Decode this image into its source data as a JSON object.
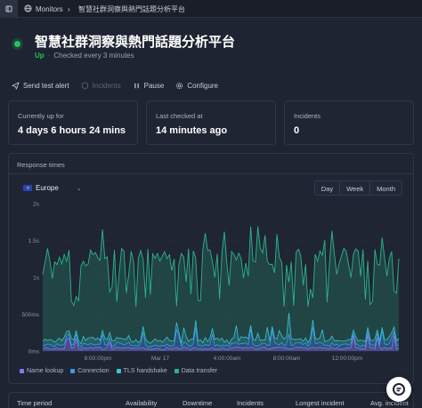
{
  "breadcrumb": {
    "monitors_label": "Monitors",
    "separator": "›",
    "current": "智慧社群洞察與熱門話題分析平台"
  },
  "header": {
    "title": "智慧社群洞察與熱門話題分析平台",
    "status": "Up",
    "separator": "·",
    "check_interval": "Checked every 3 minutes",
    "status_color": "#22c55e"
  },
  "actions": {
    "send_test_alert": "Send test alert",
    "incidents": "Incidents",
    "pause": "Pause",
    "configure": "Configure"
  },
  "stats": [
    {
      "label": "Currently up for",
      "value": "4 days 6 hours 24 mins"
    },
    {
      "label": "Last checked at",
      "value": "14 minutes ago"
    },
    {
      "label": "Incidents",
      "value": "0"
    }
  ],
  "response_times": {
    "title": "Response times",
    "region": "Europe",
    "range_buttons": [
      "Day",
      "Week",
      "Month"
    ]
  },
  "chart_data": {
    "type": "area",
    "y_ticks": [
      "0ms",
      "500ms",
      "1s",
      "1.5s",
      "2s"
    ],
    "ylim": [
      0,
      2000
    ],
    "x_ticks": [
      "8:00:00pm",
      "Mar 17",
      "4:00:00am",
      "8:00:00am",
      "12:00:00pm"
    ],
    "series": [
      {
        "name": "Name lookup",
        "color": "#7c7cf0"
      },
      {
        "name": "Connection",
        "color": "#3b9be8"
      },
      {
        "name": "TLS handshake",
        "color": "#38c6c9"
      },
      {
        "name": "Data transfer",
        "color": "#2bb58a"
      }
    ]
  },
  "table": {
    "headers": [
      "Time period",
      "Availability",
      "Downtime",
      "Incidents",
      "Longest incident",
      "Avg. incident"
    ]
  }
}
